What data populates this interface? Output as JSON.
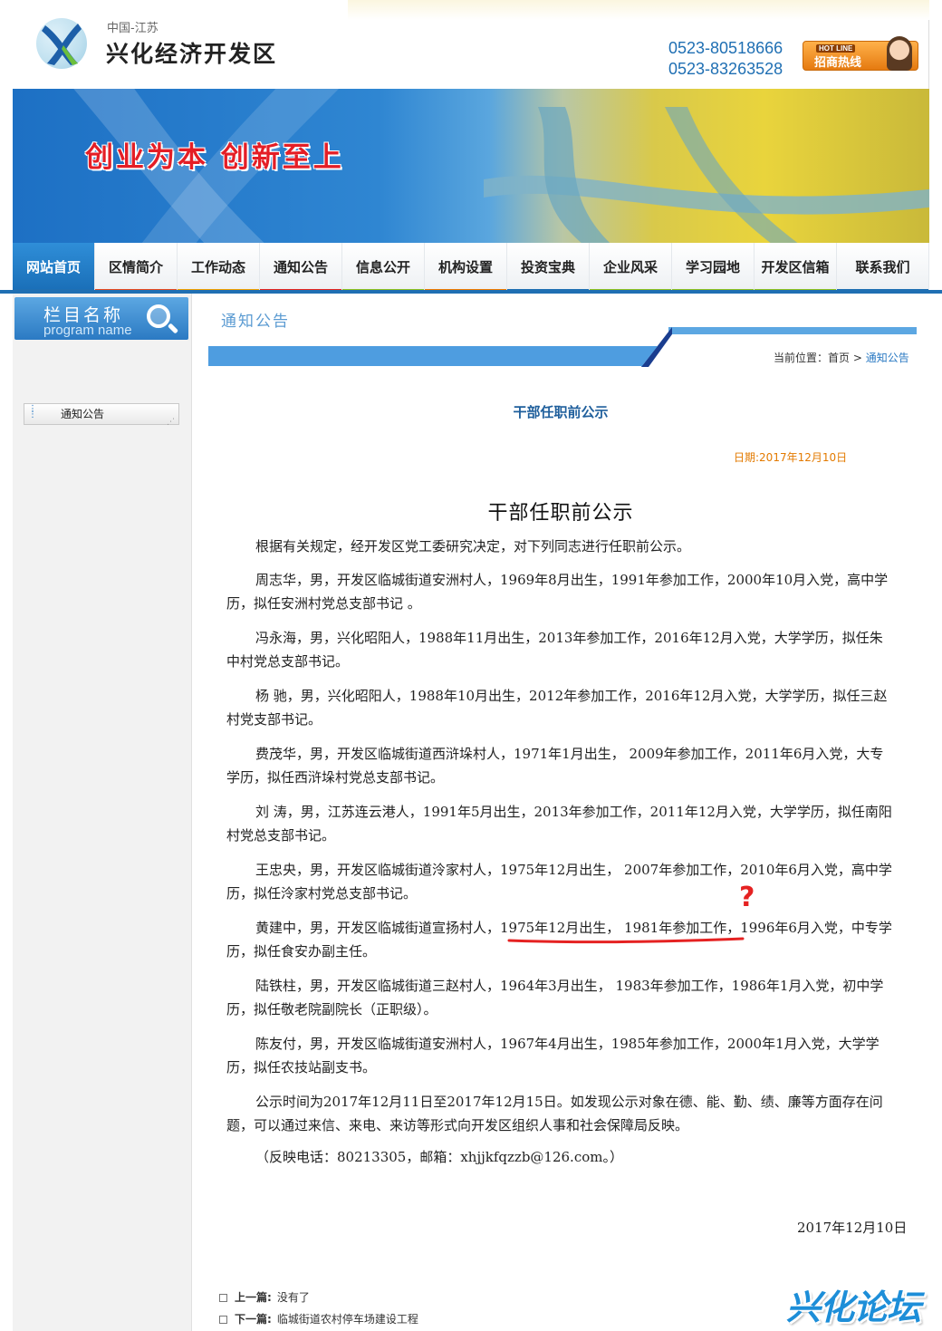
{
  "header": {
    "subtitle": "中国-江苏",
    "title": "兴化经济开发区",
    "phone1": "0523-80518666",
    "phone2": "0523-83263528",
    "hotline_en": "HOT LINE",
    "hotline_cn": "招商热线"
  },
  "banner": {
    "slogan": "创业为本  创新至上"
  },
  "nav": {
    "items": [
      {
        "label": "网站首页",
        "color": "#1f6fb3"
      },
      {
        "label": "区情简介",
        "color": "#e94a1f"
      },
      {
        "label": "工作动态",
        "color": "#f2a100"
      },
      {
        "label": "通知公告",
        "color": "#e6261f"
      },
      {
        "label": "信息公开",
        "color": "#8dc21f"
      },
      {
        "label": "机构设置",
        "color": "#f07c00"
      },
      {
        "label": "投资宝典",
        "color": "#1f6fb3"
      },
      {
        "label": "企业风采",
        "color": "#8dc21f"
      },
      {
        "label": "学习园地",
        "color": "#8dc21f"
      },
      {
        "label": "开发区信箱",
        "color": "#8dc21f"
      },
      {
        "label": "联系我们",
        "color": "#1f6fb3"
      }
    ]
  },
  "sidebar": {
    "head_cn": "栏目名称",
    "head_en": "program name",
    "link": "通知公告"
  },
  "main": {
    "section_title": "通知公告",
    "breadcrumb_label": "当前位置：",
    "breadcrumb_home": "首页",
    "breadcrumb_sep": " > ",
    "breadcrumb_current": "通知公告",
    "article_title": "干部任职前公示",
    "article_date": "日期:2017年12月10日",
    "doc_title": "干部任职前公示",
    "paragraphs": [
      "根据有关规定，经开发区党工委研究决定，对下列同志进行任职前公示。",
      "周志华，男，开发区临城街道安洲村人，1969年8月出生，1991年参加工作，2000年10月入党，高中学历，拟任安洲村党总支部书记 。",
      " 冯永海，男，兴化昭阳人，1988年11月出生，2013年参加工作，2016年12月入党，大学学历，拟任朱中村党总支部书记。",
      "杨  驰，男，兴化昭阳人，1988年10月出生，2012年参加工作，2016年12月入党，大学学历，拟任三赵村党支部书记。",
      "费茂华，男，开发区临城街道西浒垛村人，1971年1月出生，  2009年参加工作，2011年6月入党，大专学历，拟任西浒垛村党总支部书记。",
      " 刘  涛，男，江苏连云港人，1991年5月出生，2013年参加工作，2011年12月入党，大学学历，拟任南阳村党总支部书记。",
      "王忠央，男，开发区临城街道泠家村人，1975年12月出生，   2007年参加工作，2010年6月入党，高中学历，拟任泠家村党总支部书记。",
      "黄建中，男，开发区临城街道宣扬村人，1975年12月出生，   1981年参加工作，1996年6月入党，中专学历，拟任食安办副主任。",
      " 陆铁柱，男，开发区临城街道三赵村人，1964年3月出生，   1983年参加工作，1986年1月入党，初中学历，拟任敬老院副院长（正职级）。",
      "陈友付，男，开发区临城街道安洲村人，1967年4月出生，1985年参加工作，2000年1月入党，大学学历，拟任农技站副支书。",
      "公示时间为2017年12月11日至2017年12月15日。如发现公示对象在德、能、勤、绩、廉等方面存在问题，可以通过来信、来电、来访等形式向开发区组织人事和社会保障局反映。"
    ],
    "contact": "（反映电话：80213305，邮箱：xhjjkfqzzb@126.com。）",
    "sign_date": "2017年12月10日",
    "prev_label": "上一篇:",
    "prev_value": "没有了",
    "next_label": "下一篇:",
    "next_value": "临城街道农村停车场建设工程"
  },
  "annotation": {
    "mark": "?"
  },
  "watermark": {
    "text": "兴化论坛"
  }
}
